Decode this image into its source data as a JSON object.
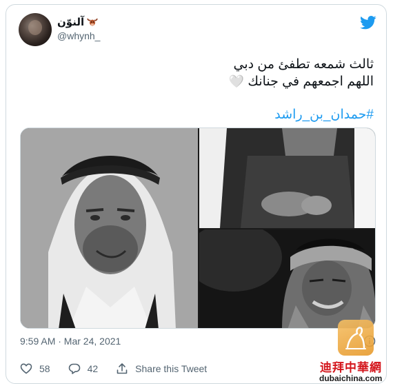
{
  "user": {
    "display_name": "آلنوّن",
    "handle": "@whynh_"
  },
  "tweet": {
    "lines": [
      "ثالث شمعه تطفئ من دبي",
      "اللهم اجمعهم في جنانك"
    ],
    "heart_emoji": "🤍",
    "hashtag": "#حمدان_بن_راشد"
  },
  "media": {
    "photo_count": 3
  },
  "meta": {
    "timestamp": "9:59 AM · Mar 24, 2021"
  },
  "actions": {
    "like_count": "58",
    "reply_count": "42",
    "share_label": "Share this Tweet"
  },
  "watermark": {
    "chinese": "迪拜中華網",
    "url": "dubaichina.com"
  },
  "colors": {
    "accent": "#1d9bf0",
    "text": "#0f1419",
    "muted": "#536471",
    "border": "#cfd9de",
    "watermark_red": "#d4161c"
  },
  "icons": [
    "bull-icon",
    "twitter-icon",
    "info-icon",
    "heart-icon",
    "reply-icon",
    "share-icon"
  ]
}
